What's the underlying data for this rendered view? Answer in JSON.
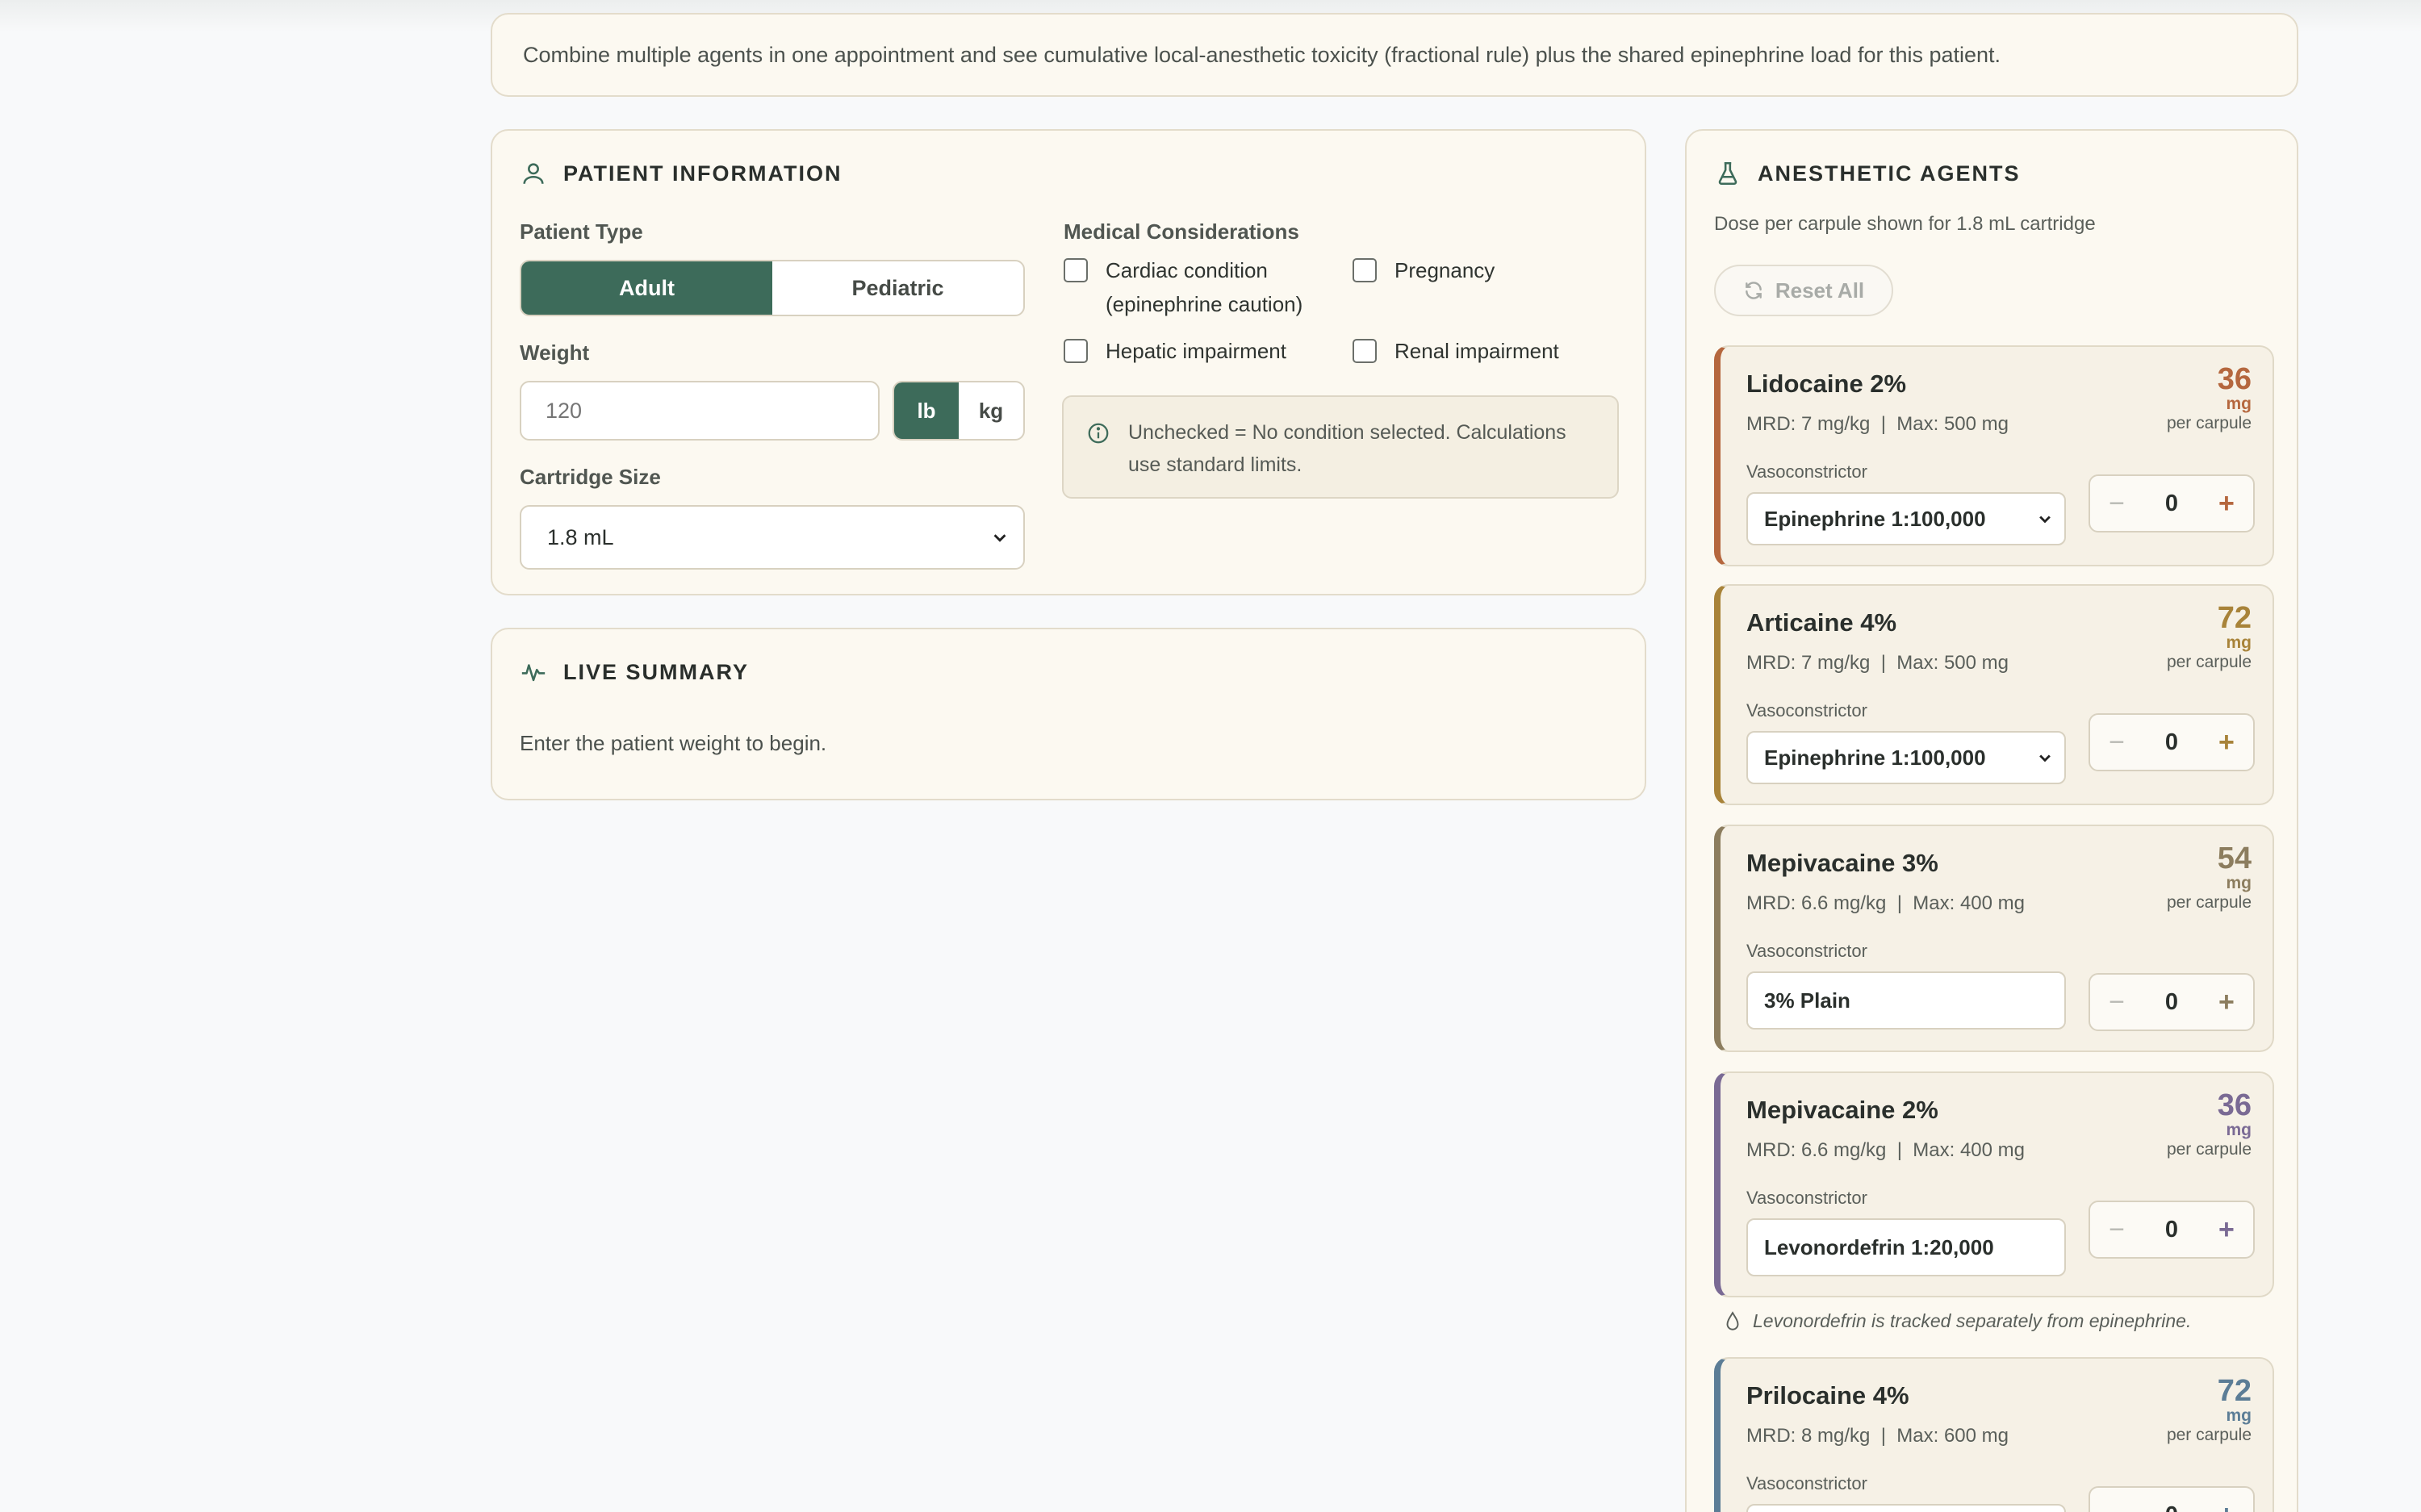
{
  "intro": {
    "text": "Combine multiple agents in one appointment and see cumulative local-anesthetic toxicity (fractional rule) plus the shared epinephrine load for this patient."
  },
  "patient": {
    "title": "PATIENT INFORMATION",
    "type_label": "Patient Type",
    "type_options": [
      "Adult",
      "Pediatric"
    ],
    "type_selected": "Adult",
    "weight_label": "Weight",
    "weight_placeholder": "120",
    "weight_value": "",
    "units": [
      "lb",
      "kg"
    ],
    "unit_selected": "lb",
    "cartridge_label": "Cartridge Size",
    "cartridge_value": "1.8 mL",
    "medical_label": "Medical Considerations",
    "conditions": [
      {
        "label": "Cardiac condition\n(epinephrine caution)",
        "checked": false
      },
      {
        "label": "Pregnancy",
        "checked": false
      },
      {
        "label": "Hepatic impairment",
        "checked": false
      },
      {
        "label": "Renal impairment",
        "checked": false
      }
    ],
    "note": "Unchecked = No condition selected. Calculations use standard limits."
  },
  "summary": {
    "title": "LIVE SUMMARY",
    "text": "Enter the patient weight to begin."
  },
  "agents": {
    "title": "ANESTHETIC AGENTS",
    "subtitle": "Dose per carpule shown for 1.8 mL cartridge",
    "reset_label": "Reset All",
    "vasoconstrictor_label": "Vasoconstrictor",
    "dose_unit": "mg",
    "dose_per": "per carpule",
    "levonordefrin_note": "Levonordefrin is tracked separately from epinephrine.",
    "items": [
      {
        "name": "Lidocaine 2%",
        "mrd": "MRD: 7 mg/kg  |  Max: 500 mg",
        "dose": "36",
        "vasoconstrictor": "Epinephrine 1:100,000",
        "selectable": true,
        "count": "0",
        "color": "#b5673e"
      },
      {
        "name": "Articaine 4%",
        "mrd": "MRD: 7 mg/kg  |  Max: 500 mg",
        "dose": "72",
        "vasoconstrictor": "Epinephrine 1:100,000",
        "selectable": true,
        "count": "0",
        "color": "#a88339"
      },
      {
        "name": "Mepivacaine 3%",
        "mrd": "MRD: 6.6 mg/kg  |  Max: 400 mg",
        "dose": "54",
        "vasoconstrictor": "3% Plain",
        "selectable": false,
        "count": "0",
        "color": "#8c7d5e"
      },
      {
        "name": "Mepivacaine 2%",
        "mrd": "MRD: 6.6 mg/kg  |  Max: 400 mg",
        "dose": "36",
        "vasoconstrictor": "Levonordefrin 1:20,000",
        "selectable": false,
        "count": "0",
        "color": "#7a6a94"
      },
      {
        "name": "Prilocaine 4%",
        "mrd": "MRD: 8 mg/kg  |  Max: 600 mg",
        "dose": "72",
        "vasoconstrictor": "",
        "selectable": false,
        "count": "0",
        "color": "#5c7d96"
      }
    ]
  },
  "colors": {
    "accent": "#3d6b5a",
    "card_bg": "#fcf9f1",
    "border": "#e3dccb"
  },
  "icons": {
    "patient": "user-icon",
    "summary": "pulse-icon",
    "agents": "flask-icon",
    "reset": "refresh-icon",
    "note": "info-icon",
    "levo": "droplet-icon"
  }
}
